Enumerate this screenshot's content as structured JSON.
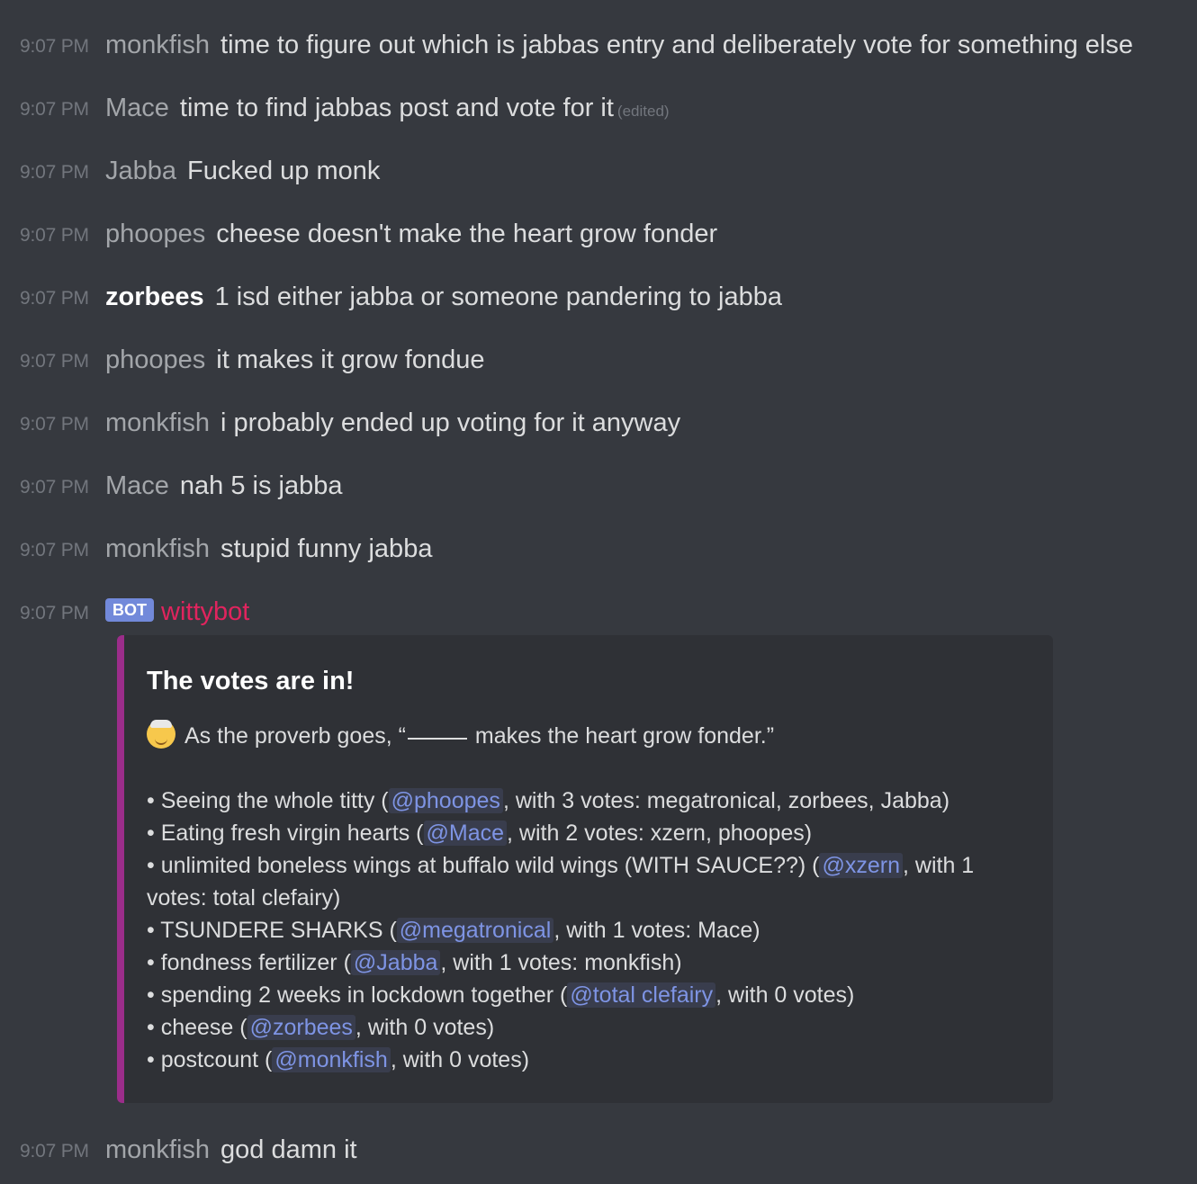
{
  "messages": [
    {
      "time": "9:07 PM",
      "author": "monkfish",
      "text": "time to figure out which is jabbas entry and deliberately vote for something else"
    },
    {
      "time": "9:07 PM",
      "author": "Mace",
      "text": "time to find jabbas post and vote for it",
      "edited": "(edited)"
    },
    {
      "time": "9:07 PM",
      "author": "Jabba",
      "text": "Fucked up monk"
    },
    {
      "time": "9:07 PM",
      "author": "phoopes",
      "text": "cheese doesn't make the heart grow fonder"
    },
    {
      "time": "9:07 PM",
      "author": "zorbees",
      "text": "1 isd either jabba or someone pandering to jabba"
    },
    {
      "time": "9:07 PM",
      "author": "phoopes",
      "text": "it makes it grow fondue"
    },
    {
      "time": "9:07 PM",
      "author": "monkfish",
      "text": "i probably ended up voting for it anyway"
    },
    {
      "time": "9:07 PM",
      "author": "Mace",
      "text": "nah 5 is jabba"
    },
    {
      "time": "9:07 PM",
      "author": "monkfish",
      "text": "stupid funny jabba"
    }
  ],
  "bot_message": {
    "time": "9:07 PM",
    "badge": "BOT",
    "author": "wittybot",
    "author_color": "#e0245e",
    "embed": {
      "accent_color": "#9b2d8a",
      "title": "The votes are in!",
      "icon": "old-man-emoji-icon",
      "proverb_before": "As the proverb goes, “",
      "proverb_after": " makes the heart grow fonder.”",
      "items": [
        {
          "prefix": "• Seeing the whole titty (",
          "mention": "@phoopes",
          "suffix": ", with 3 votes: megatronical, zorbees, Jabba)"
        },
        {
          "prefix": "• Eating fresh virgin hearts (",
          "mention": "@Mace",
          "suffix": ", with 2 votes: xzern, phoopes)"
        },
        {
          "prefix": "• unlimited boneless wings at buffalo wild wings (WITH SAUCE??) (",
          "mention": "@xzern",
          "suffix": ", with 1 votes: total clefairy)"
        },
        {
          "prefix": "• TSUNDERE SHARKS (",
          "mention": "@megatronical",
          "suffix": ", with 1 votes: Mace)"
        },
        {
          "prefix": "• fondness fertilizer (",
          "mention": "@Jabba",
          "suffix": ", with 1 votes: monkfish)"
        },
        {
          "prefix": "• spending 2 weeks in lockdown together (",
          "mention": "@total clefairy",
          "suffix": ", with 0 votes)"
        },
        {
          "prefix": "• cheese (",
          "mention": "@zorbees",
          "suffix": ", with 0 votes)"
        },
        {
          "prefix": "• postcount (",
          "mention": "@monkfish",
          "suffix": ", with 0 votes)"
        }
      ]
    }
  },
  "last_message": {
    "time": "9:07 PM",
    "author": "monkfish",
    "text": "god damn it"
  },
  "colors": {
    "background": "#36393f",
    "embed_background": "#2f3136",
    "mention": "#7e94e4",
    "bot_badge": "#7289da"
  }
}
